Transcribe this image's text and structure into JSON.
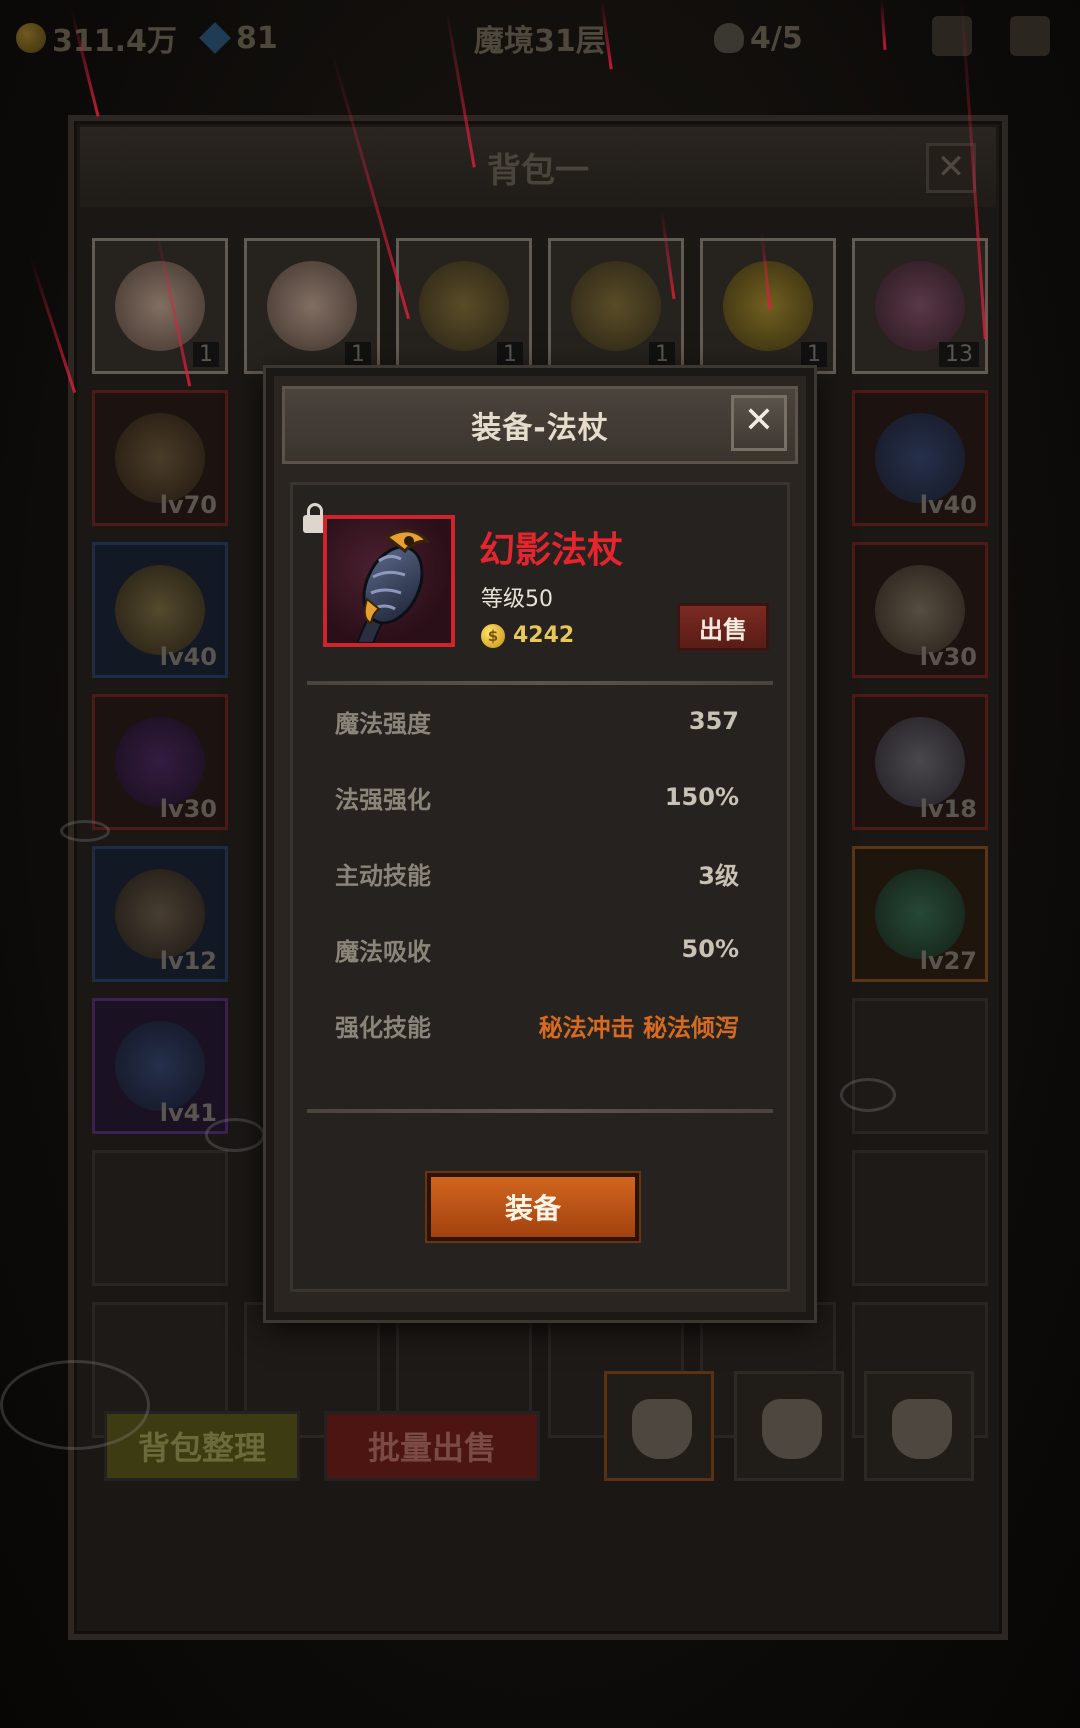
{
  "topbar": {
    "gold": "311.4万",
    "gems": "81",
    "floor": "魔境31层",
    "lives": "4/5"
  },
  "bag": {
    "title": "背包一",
    "close_symbol": "✕",
    "row1_quantities": [
      "1",
      "1",
      "1",
      "1",
      "1",
      "13"
    ],
    "left_levels": [
      "lv70",
      "lv40",
      "lv30",
      "lv12",
      "lv41"
    ],
    "right_levels": [
      "lv40",
      "lv30",
      "lv18",
      "lv27"
    ],
    "sort_label": "背包整理",
    "bulk_sell_label": "批量出售"
  },
  "dialog": {
    "title": "装备-法杖",
    "close_symbol": "✕",
    "item": {
      "name": "幻影法杖",
      "level": "等级50",
      "price": "4242",
      "gold_symbol": "$"
    },
    "sell_label": "出售",
    "stats": [
      {
        "label": "魔法强度",
        "value": "357"
      },
      {
        "label": "法强强化",
        "value": "150%"
      },
      {
        "label": "主动技能",
        "value": "3级"
      },
      {
        "label": "魔法吸收",
        "value": "50%"
      },
      {
        "label": "强化技能",
        "value": "秘法冲击 秘法倾泻"
      }
    ],
    "equip_label": "装备"
  },
  "colors": {
    "item_name": "#e5252d",
    "rarity_border": "#d0232a",
    "equip_button": "#c0561a",
    "skill_text": "#d66a1f",
    "rain": "#dc1e3c"
  }
}
